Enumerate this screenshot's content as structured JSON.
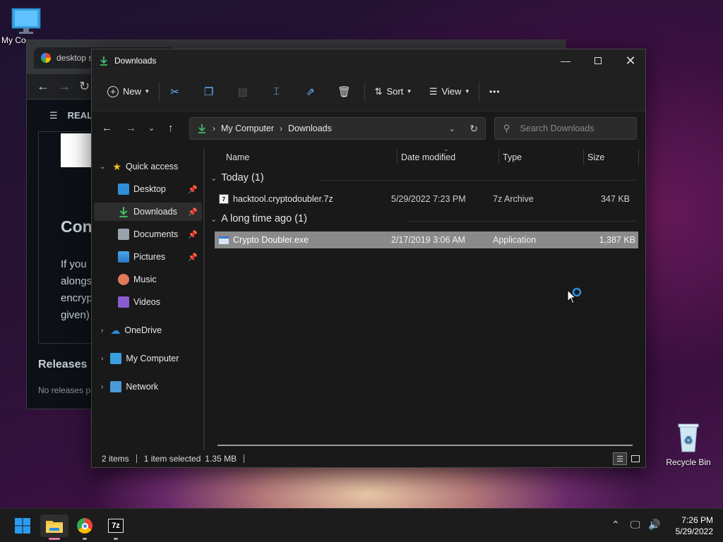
{
  "desktop": {
    "my_computer_label": "My Co",
    "recycle_bin_label": "Recycle Bin"
  },
  "browser": {
    "tab_title": "desktop s",
    "readme_label": "REAL",
    "heading_fragment": "Con",
    "para_lines": [
      "If you",
      "alongs",
      "encryp",
      "given)"
    ],
    "releases_label": "Releases",
    "releases_text": "No releases pu"
  },
  "explorer": {
    "title": "Downloads",
    "toolbar": {
      "new_label": "New",
      "sort_label": "Sort",
      "view_label": "View",
      "more_label": "•••"
    },
    "address": {
      "crumbs": [
        "My Computer",
        "Downloads"
      ],
      "search_placeholder": "Search Downloads"
    },
    "nav": {
      "quick_access": "Quick access",
      "items": [
        {
          "label": "Desktop",
          "pinned": true
        },
        {
          "label": "Downloads",
          "pinned": true,
          "selected": true
        },
        {
          "label": "Documents",
          "pinned": true
        },
        {
          "label": "Pictures",
          "pinned": true
        },
        {
          "label": "Music"
        },
        {
          "label": "Videos"
        }
      ],
      "onedrive": "OneDrive",
      "my_computer": "My Computer",
      "network": "Network"
    },
    "columns": {
      "name": "Name",
      "date": "Date modified",
      "type": "Type",
      "size": "Size"
    },
    "groups": [
      {
        "label": "Today (1)",
        "files": [
          {
            "name": "hacktool.cryptodoubler.7z",
            "date": "5/29/2022 7:23 PM",
            "type": "7z Archive",
            "size": "347 KB"
          }
        ]
      },
      {
        "label": "A long time ago (1)",
        "files": [
          {
            "name": "Crypto Doubler.exe",
            "date": "2/17/2019 3:06 AM",
            "type": "Application",
            "size": "1,387 KB",
            "selected": true
          }
        ]
      }
    ],
    "status": {
      "count": "2 items",
      "selection": "1 item selected",
      "size": "1.35 MB"
    }
  },
  "taskbar": {
    "time": "7:26 PM",
    "date": "5/29/2022",
    "sevenzip_label": "7z"
  },
  "colors": {
    "accent": "#0078d4",
    "selected_row": "#8a8a8a",
    "nav_selected": "#2d2d2d"
  }
}
